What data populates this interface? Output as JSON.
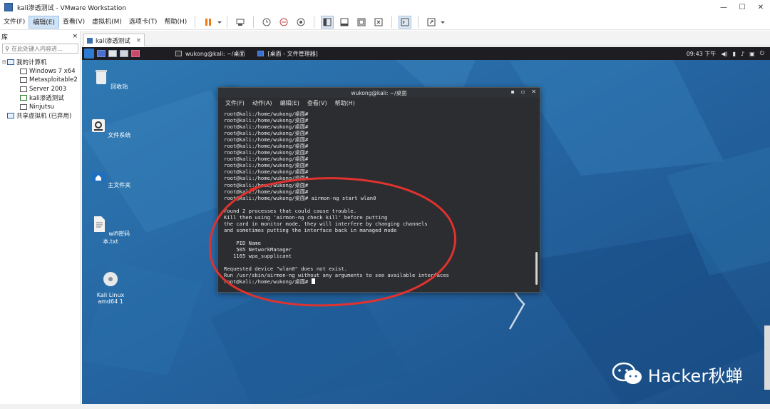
{
  "window": {
    "title": "kali渗透测试 - VMware Workstation",
    "controls": [
      "—",
      "☐",
      "✕"
    ]
  },
  "menubar": {
    "items": [
      "文件(F)",
      "编辑(E)",
      "查看(V)",
      "虚拟机(M)",
      "选项卡(T)",
      "帮助(H)"
    ]
  },
  "library": {
    "header": "库",
    "close": "×",
    "search_placeholder": "在此处键入内容进…",
    "tree": {
      "root": "我的计算机",
      "vms": [
        "Windows 7 x64",
        "Metasploitable2",
        "Server 2003",
        "kali渗透测试",
        "Ninjutsu"
      ],
      "shared": "共享虚拟机 (已弃用)"
    }
  },
  "vm_tab": {
    "label": "kali渗透测试",
    "close": "×"
  },
  "kali_panel": {
    "task1": "wukong@kali: ~/桌面",
    "task2": "[桌面 - 文件管理器]",
    "clock": "09:43 下午"
  },
  "desktop_icons": [
    "回收站",
    "文件系统",
    "主文件夹",
    "wifi密码本.txt",
    "Kali Linux\namd64 1"
  ],
  "terminal": {
    "title": "wukong@kali: ~/桌面",
    "menu": [
      "文件(F)",
      "动作(A)",
      "编辑(E)",
      "查看(V)",
      "帮助(H)"
    ],
    "prompt": "root@kali:/home/wukong/桌面#",
    "command": "airmon-ng start wlan0",
    "lines": [
      "",
      "Found 2 processes that could cause trouble.",
      "Kill them using 'airmon-ng check kill' before putting",
      "the card in monitor mode, they will interfere by changing channels",
      "and sometimes putting the interface back in managed mode",
      "",
      "    PID Name",
      "    505 NetworkManager",
      "   1165 wpa_supplicant",
      "",
      "Requested device \"wlan0\" does not exist.",
      "Run /usr/sbin/airmon-ng without any arguments to see available interfaces"
    ]
  },
  "watermark": "Hacker秋蝉"
}
